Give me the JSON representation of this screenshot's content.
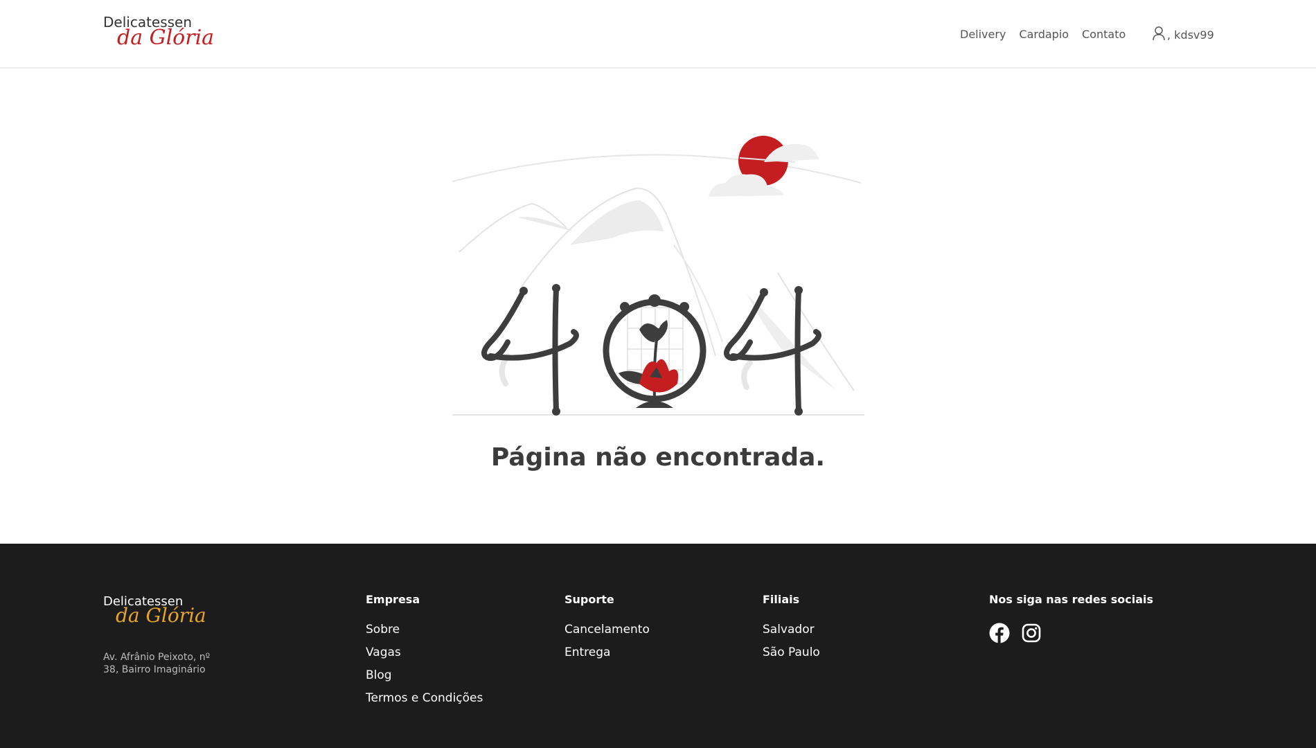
{
  "header": {
    "logo_top": "Delicatessen",
    "logo_bottom": "da Glória",
    "nav": [
      {
        "label": "Delivery"
      },
      {
        "label": "Cardapio"
      },
      {
        "label": "Contato"
      }
    ],
    "user_icon": "user-icon",
    "user_name": ", kdsv99"
  },
  "main": {
    "error_code": "404",
    "message": "Página não encontrada."
  },
  "footer": {
    "logo_top": "Delicatessen",
    "logo_bottom": "da Glória",
    "address": "Av. Afrânio Peixoto, nº 38, Bairro Imaginário",
    "columns": {
      "empresa": {
        "title": "Empresa",
        "links": [
          "Sobre",
          "Vagas",
          "Blog",
          "Termos e Condições"
        ]
      },
      "suporte": {
        "title": "Suporte",
        "links": [
          "Cancelamento",
          "Entrega"
        ]
      },
      "filiais": {
        "title": "Filiais",
        "links": [
          "Salvador",
          "São Paulo"
        ]
      },
      "social": {
        "title": "Nos siga nas redes sociais",
        "icons": [
          "facebook-icon",
          "instagram-icon"
        ]
      }
    }
  },
  "colors": {
    "accent_red": "#c41e20",
    "footer_bg": "#1c1c1c",
    "footer_logo": "#e6a62e",
    "text_dark": "#3b3b3b"
  }
}
